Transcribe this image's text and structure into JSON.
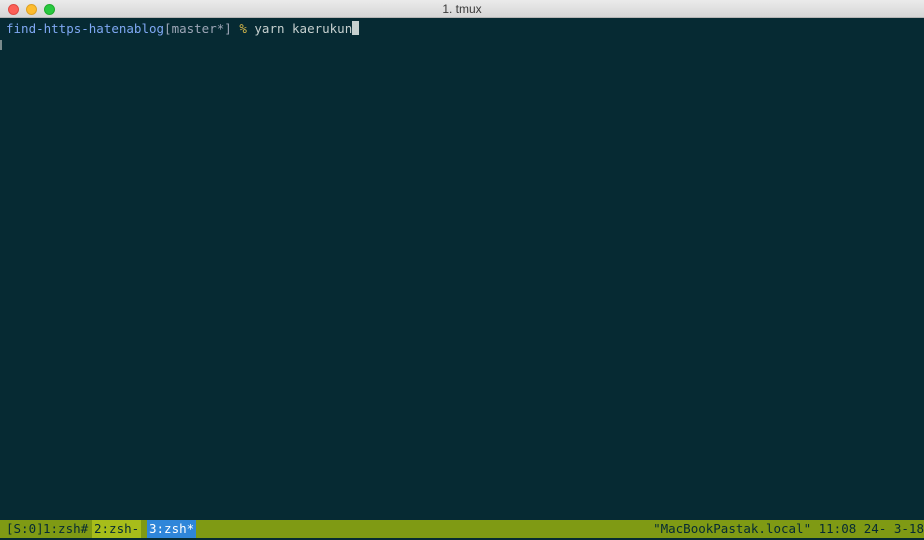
{
  "window": {
    "title": "1. tmux"
  },
  "terminal": {
    "cwd": "find-https-hatenablog",
    "branch_open": "[",
    "branch": "master*",
    "branch_close": "]",
    "prompt_symbol": "%",
    "command": "yarn kaerukun"
  },
  "tmux": {
    "session": "[S:0]",
    "windows": [
      {
        "label": "1:zsh#",
        "active": false
      },
      {
        "label": "2:zsh-",
        "active": false
      },
      {
        "label": "3:zsh*",
        "active": true
      }
    ],
    "right_status": "\"MacBookPastak.local\" 11:08 24- 3-18"
  },
  "colors": {
    "terminal_bg": "#062a33",
    "statusbar_bg": "#7f9a14",
    "active_window_bg": "#2f86d9",
    "directory_fg": "#7fa8f3",
    "prompt_symbol_fg": "#d8b94a"
  }
}
